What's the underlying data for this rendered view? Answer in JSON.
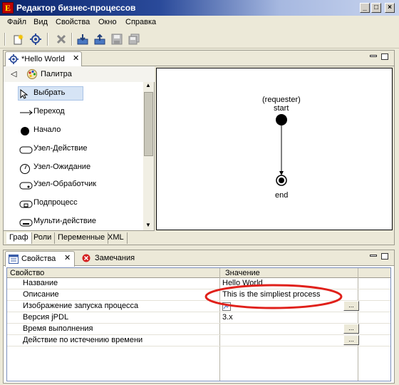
{
  "window": {
    "title": "Редактор бизнес-процессов",
    "app_icon_letter": "E"
  },
  "menu": [
    "Файл",
    "Вид",
    "Свойства",
    "Окно",
    "Справка"
  ],
  "editor": {
    "tab_title": "*Hello World",
    "palette_title": "Палитра",
    "palette_items": [
      "Выбрать",
      "Переход",
      "Начало",
      "Узел-Действие",
      "Узел-Ожидание",
      "Узел-Обработчик",
      "Подпроцесс",
      "Мульти-действие"
    ],
    "bottom_tabs": [
      "Граф",
      "Роли",
      "Переменные",
      "XML"
    ]
  },
  "diagram": {
    "start_role": "(requester)",
    "start_label": "start",
    "end_label": "end"
  },
  "properties": {
    "tabs": [
      "Свойства",
      "Замечания"
    ],
    "columns": [
      "Свойство",
      "Значение"
    ],
    "rows": [
      {
        "name": "Название",
        "value": "Hello World"
      },
      {
        "name": "Описание",
        "value": "This is the simpliest process"
      },
      {
        "name": "Изображение запуска процесса",
        "value": ""
      },
      {
        "name": "Версия jPDL",
        "value": "3.x"
      },
      {
        "name": "Время выполнения",
        "value": ""
      },
      {
        "name": "Действие по истечению времени",
        "value": ""
      }
    ],
    "ellipsis_label": "..."
  },
  "colors": {
    "highlight_ellipse": "#e0201a",
    "selected_item": "#d6e4f5"
  }
}
